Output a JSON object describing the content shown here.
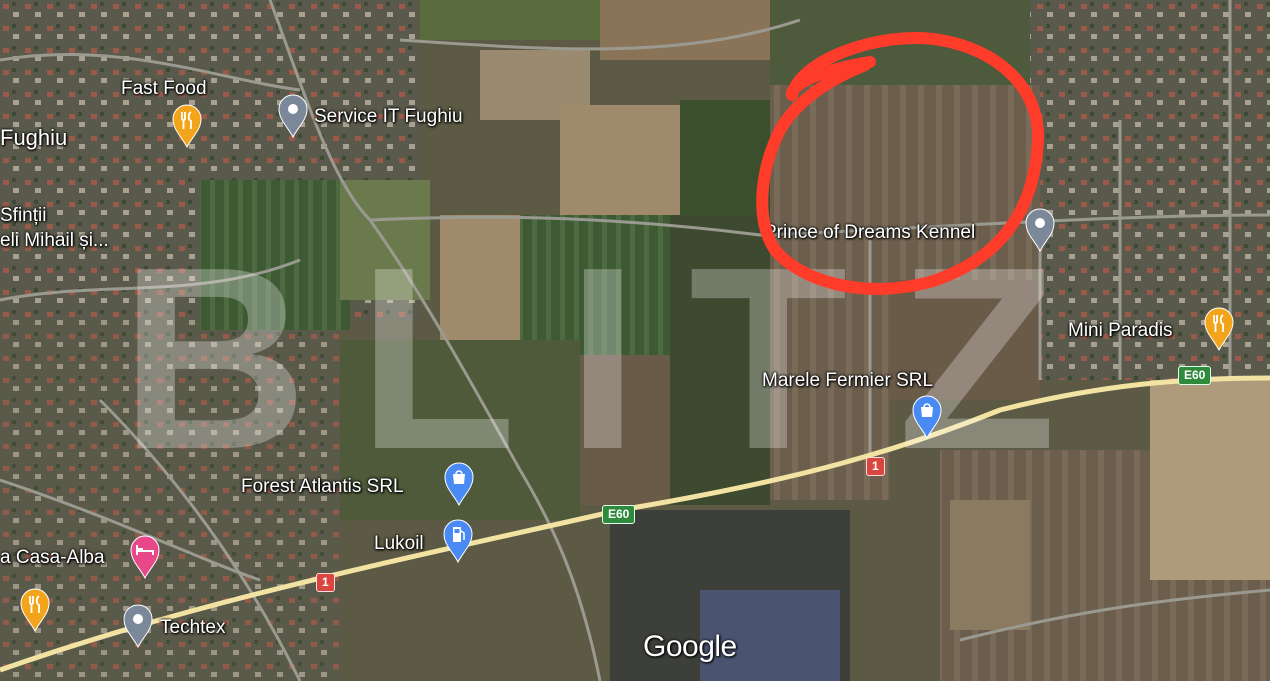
{
  "places": [
    {
      "id": "fast-food",
      "label": "Fast Food",
      "icon": "restaurant-icon",
      "color": "#f2a51a"
    },
    {
      "id": "service-it-fughiu",
      "label": "Service IT Fughiu",
      "icon": "location-pin-icon",
      "color": "#7a8899"
    },
    {
      "id": "fughiu",
      "label": "Fughiu",
      "icon": "",
      "color": ""
    },
    {
      "id": "sfintii",
      "label": "Sfinții",
      "icon": "",
      "color": ""
    },
    {
      "id": "mihail",
      "label": "eli Mihail și...",
      "icon": "",
      "color": ""
    },
    {
      "id": "prince-of-dreams-kennel",
      "label": "Prince of Dreams Kennel",
      "icon": "location-pin-icon",
      "color": "#7a8899"
    },
    {
      "id": "mini-paradis",
      "label": "Mini Paradis",
      "icon": "restaurant-icon",
      "color": "#f2a51a"
    },
    {
      "id": "marele-fermier-srl",
      "label": "Marele Fermier SRL",
      "icon": "shopping-bag-icon",
      "color": "#4a8af4"
    },
    {
      "id": "forest-atlantis-srl",
      "label": "Forest Atlantis SRL",
      "icon": "shopping-bag-icon",
      "color": "#4a8af4"
    },
    {
      "id": "lukoil",
      "label": "Lukoil",
      "icon": "gas-station-icon",
      "color": "#4a8af4"
    },
    {
      "id": "casa-alba",
      "label": "a Casa-Alba",
      "icon": "hotel-bed-icon",
      "color": "#e8478a"
    },
    {
      "id": "restaurant-left",
      "label": "",
      "icon": "restaurant-icon",
      "color": "#f2a51a"
    },
    {
      "id": "techtex",
      "label": "Techtex",
      "icon": "location-pin-icon",
      "color": "#7a8899"
    }
  ],
  "roads": {
    "e60_label": "E60",
    "route1_label": "1"
  },
  "watermark": "BLITZ",
  "attribution": "Google",
  "annotation": {
    "shape": "hand-drawn circle",
    "color": "#ff3b2a"
  }
}
